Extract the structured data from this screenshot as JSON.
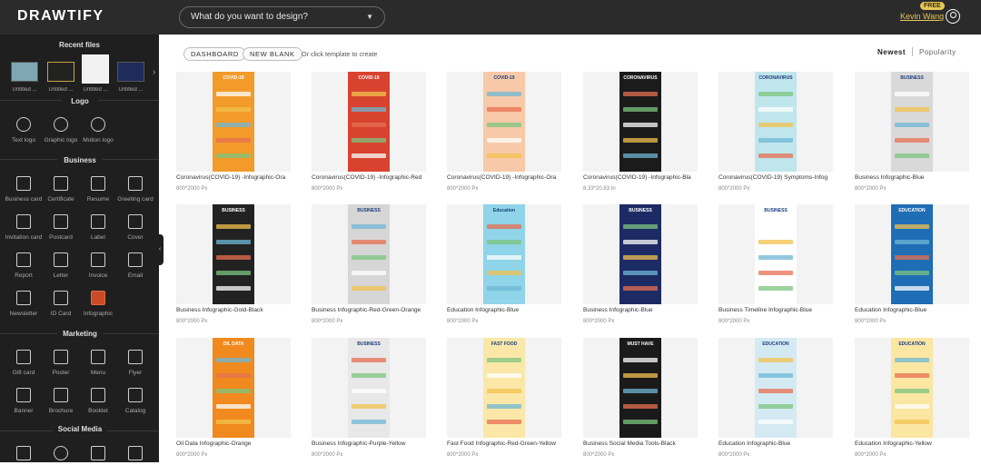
{
  "app": {
    "logo": "DRAWTIFY"
  },
  "search": {
    "placeholder": "What do you want to design?"
  },
  "user": {
    "badge": "FREE",
    "name": "Kevin Wang"
  },
  "sidebar": {
    "recent_title": "Recent files",
    "recent": [
      {
        "label": "Untitled ..."
      },
      {
        "label": "Untitled ..."
      },
      {
        "label": "Untitled ..."
      },
      {
        "label": "Untitled ..."
      }
    ],
    "sections": {
      "logo": "Logo",
      "business": "Business",
      "marketing": "Marketing",
      "social": "Social Media"
    },
    "logo_items": [
      "Text logo",
      "Graphic logo",
      "Motion logo"
    ],
    "business_items": [
      "Business card",
      "Certificate",
      "Resume",
      "Greeting card",
      "Invitation card",
      "Postcard",
      "Label",
      "Cover",
      "Report",
      "Letter",
      "Invoice",
      "Email",
      "Newsletter",
      "ID Card",
      "Infographic"
    ],
    "marketing_items": [
      "Gift card",
      "Poster",
      "Menu",
      "Flyer",
      "Banner",
      "Brochure",
      "Booklet",
      "Catalog"
    ]
  },
  "toolbar": {
    "dashboard": "DASHBOARD",
    "new_blank": "NEW BLANK",
    "hint": "Or click template to create",
    "sort_newest": "Newest",
    "sort_popularity": "Popularity"
  },
  "templates": [
    {
      "title": "Coronavirus(COVID-19) -Infographic-Ora",
      "size": "800*2000 Px",
      "color": "#f39b2a",
      "head": "COVID-19"
    },
    {
      "title": "Coronavirus(COVID-19) -Infographic-Red",
      "size": "800*2000 Px",
      "color": "#d8432f",
      "head": "COVID-19"
    },
    {
      "title": "Coronavirus(COVID-19) -Infographic-Ora",
      "size": "800*2000 Px",
      "color": "#f7c9a8",
      "head": "COVID-19"
    },
    {
      "title": "Coronavirus(COVID-19) -Infographic-Bla",
      "size": "8.33*20.83 In",
      "color": "#1b1b1b",
      "head": "CORONAVIRUS"
    },
    {
      "title": "Coronavirus(COVID-19) Symptoms-Infog",
      "size": "800*2000 Px",
      "color": "#bfe6ec",
      "head": "CORONAVIRUS"
    },
    {
      "title": "Business Infographic-Blue",
      "size": "800*2000 Px",
      "color": "#d9d9d9",
      "head": "BUSINESS"
    },
    {
      "title": "Business Infographic-Gold-Black",
      "size": "800*2000 Px",
      "color": "#222222",
      "head": "BUSINESS"
    },
    {
      "title": "Business Infographic-Red-Green-Orange",
      "size": "800*2000 Px",
      "color": "#d6d6d6",
      "head": "BUSINESS"
    },
    {
      "title": "Education Infographic-Blue",
      "size": "800*2000 Px",
      "color": "#8fd4e8",
      "head": "Education"
    },
    {
      "title": "Business Infographic-Blue",
      "size": "800*2000 Px",
      "color": "#1c2b63",
      "head": "BUSINESS"
    },
    {
      "title": "Business Timeline Infographic-Blue",
      "size": "800*2000 Px",
      "color": "#ffffff",
      "head": "BUSINESS"
    },
    {
      "title": "Education Infographic-Blue",
      "size": "800*2000 Px",
      "color": "#1f6db5",
      "head": "EDUCATION"
    },
    {
      "title": "Oil Data Infographic-Orange",
      "size": "800*2000 Px",
      "color": "#f08a1e",
      "head": "OIL DATA"
    },
    {
      "title": "Business Infographic-Purple-Yellow",
      "size": "800*2000 Px",
      "color": "#e8e8e8",
      "head": "BUSINESS"
    },
    {
      "title": "Fast Food Infographic-Red-Green-Yellow",
      "size": "800*2000 Px",
      "color": "#fbe7a8",
      "head": "FAST FOOD"
    },
    {
      "title": "Business Social Media Tools-Black",
      "size": "800*2000 Px",
      "color": "#1a1a1a",
      "head": "MUST HAVE"
    },
    {
      "title": "Education Infographic-Blue",
      "size": "800*2000 Px",
      "color": "#d4eaf3",
      "head": "EDUCATION"
    },
    {
      "title": "Education Infographic-Yellow",
      "size": "800*2000 Px",
      "color": "#fbe6a2",
      "head": "EDUCATION"
    }
  ]
}
